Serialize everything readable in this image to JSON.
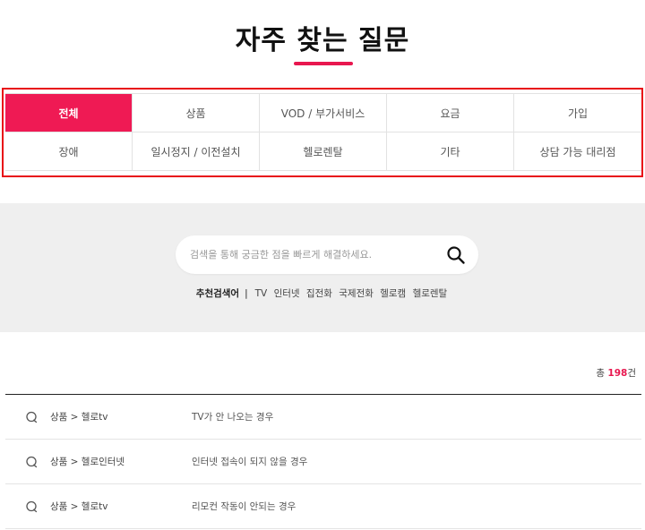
{
  "page": {
    "title": "자주 찾는 질문",
    "accent_color": "#e8174f",
    "highlight_color": "#e80f17"
  },
  "categories": [
    {
      "label": "전체",
      "active": true
    },
    {
      "label": "상품",
      "active": false
    },
    {
      "label": "VOD / 부가서비스",
      "active": false
    },
    {
      "label": "요금",
      "active": false
    },
    {
      "label": "가입",
      "active": false
    },
    {
      "label": "장애",
      "active": false
    },
    {
      "label": "일시정지 / 이전설치",
      "active": false
    },
    {
      "label": "헬로렌탈",
      "active": false
    },
    {
      "label": "기타",
      "active": false
    },
    {
      "label": "상담 가능 대리점",
      "active": false
    }
  ],
  "search": {
    "placeholder": "검색을 통해 궁금한 점을 빠르게 해결하세요.",
    "value": "",
    "button_icon": "search-icon"
  },
  "recommend": {
    "label": "추천검색어",
    "separator": "|",
    "keywords": [
      "TV",
      "인터넷",
      "집전화",
      "국제전화",
      "헬로캠",
      "헬로렌탈"
    ]
  },
  "results": {
    "total_prefix": "총",
    "total_count": "198",
    "total_suffix": "건"
  },
  "faq": [
    {
      "category": "상품 > 헬로tv",
      "question": "TV가 안 나오는 경우",
      "icon": "question-bubble-icon"
    },
    {
      "category": "상품 > 헬로인터넷",
      "question": "인터넷 접속이 되지 않을 경우",
      "icon": "question-bubble-icon"
    },
    {
      "category": "상품 > 헬로tv",
      "question": "리모컨 작동이 안되는 경우",
      "icon": "question-bubble-icon"
    }
  ]
}
